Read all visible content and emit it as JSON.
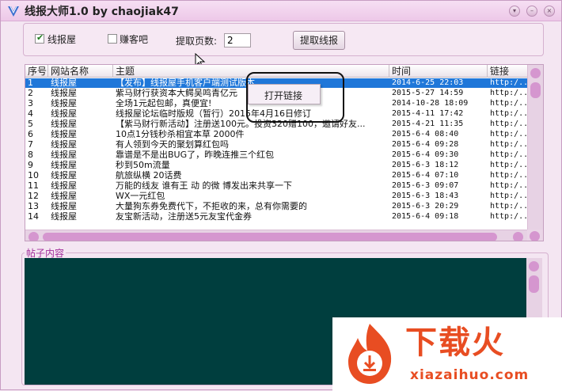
{
  "window": {
    "title": "线报大师1.0 by chaojiak47"
  },
  "controls": {
    "checkbox_xianbao": {
      "label": "线报屋",
      "checked": true
    },
    "checkbox_zhuanke": {
      "label": "赚客吧",
      "checked": false
    },
    "pages_label": "提取页数:",
    "pages_value": "2",
    "fetch_button": "提取线报"
  },
  "table": {
    "columns": [
      "序号",
      "网站名称",
      "主题",
      "时间",
      "链接"
    ],
    "rows": [
      {
        "no": "1",
        "site": "线报屋",
        "subject": "【发布】线报屋手机客户端测试版本",
        "time": "2014-6-25 22:03",
        "link": "http:/..."
      },
      {
        "no": "2",
        "site": "线报屋",
        "subject": "紫马财行获资本大鳄吴鸣青亿元",
        "time": "2015-5-27 14:59",
        "link": "http:/..."
      },
      {
        "no": "3",
        "site": "线报屋",
        "subject": "全场1元起包邮，真便宜!",
        "time": "2014-10-28 18:09",
        "link": "http:/..."
      },
      {
        "no": "4",
        "site": "线报屋",
        "subject": "线报屋论坛临时版规（暂行）2015年4月16日修订",
        "time": "2015-4-11 17:42",
        "link": "http:/..."
      },
      {
        "no": "5",
        "site": "线报屋",
        "subject": "【紫马财行新活动】注册送100元。投资320赠100，邀请好友...",
        "time": "2015-4-21 11:35",
        "link": "http:/..."
      },
      {
        "no": "6",
        "site": "线报屋",
        "subject": "10点1分钱秒杀相宜本草 2000件",
        "time": "2015-6-4 08:40",
        "link": "http:/..."
      },
      {
        "no": "7",
        "site": "线报屋",
        "subject": "有人领到今天的聚划算红包吗",
        "time": "2015-6-4 09:28",
        "link": "http:/..."
      },
      {
        "no": "8",
        "site": "线报屋",
        "subject": "靠谱是不是出BUG了，昨晚连推三个红包",
        "time": "2015-6-4 09:30",
        "link": "http:/..."
      },
      {
        "no": "9",
        "site": "线报屋",
        "subject": "秒到50m流量",
        "time": "2015-6-3 18:12",
        "link": "http:/..."
      },
      {
        "no": "10",
        "site": "线报屋",
        "subject": "航旅纵横 20话费",
        "time": "2015-6-4 07:10",
        "link": "http:/..."
      },
      {
        "no": "11",
        "site": "线报屋",
        "subject": "万能的线友 谁有王 动 的微 博发出来共享一下",
        "time": "2015-6-3 09:07",
        "link": "http:/..."
      },
      {
        "no": "12",
        "site": "线报屋",
        "subject": "WX一元红包",
        "time": "2015-6-3 18:43",
        "link": "http:/..."
      },
      {
        "no": "13",
        "site": "线报屋",
        "subject": "大量狗东券免费代下，不拒收的来，总有你需要的",
        "time": "2015-6-3 20:29",
        "link": "http:/..."
      },
      {
        "no": "14",
        "site": "线报屋",
        "subject": "友宝新活动，注册送5元友宝代金券",
        "time": "2015-6-4 09:18",
        "link": "http:/..."
      }
    ]
  },
  "context_menu": {
    "open_link": "打开链接"
  },
  "post_section": {
    "label": "帖子内容"
  },
  "watermark": {
    "title": "下载火",
    "url": "xiazaihuo.com"
  },
  "colors": {
    "selection": "#1f77d9",
    "post_bg": "#003e3e",
    "accent_pink": "#d596cf",
    "watermark": "#e84d22"
  }
}
